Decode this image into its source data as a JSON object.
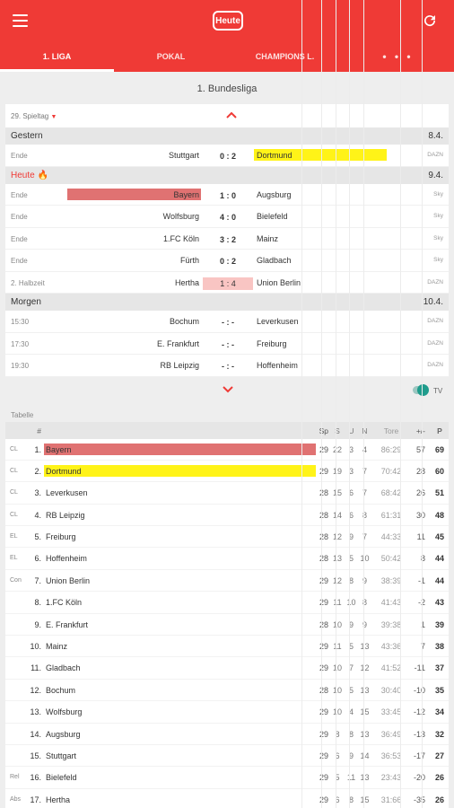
{
  "header": {
    "today_label": "Heute",
    "tabs": [
      "1. LIGA",
      "POKAL",
      "CHAMPIONS L.",
      "• • •"
    ],
    "accent": "#ef3a36"
  },
  "league_title": "1. Bundesliga",
  "matchday": "29. Spieltag",
  "days": [
    {
      "name": "Gestern",
      "date": "8.4.",
      "matches": [
        {
          "status": "Ende",
          "home": "Stuttgart",
          "score": "0 : 2",
          "away": "Dortmund",
          "tv": "DAZN",
          "away_hl": "#fff318"
        }
      ]
    },
    {
      "name": "Heute 🔥",
      "date": "9.4.",
      "today": true,
      "matches": [
        {
          "status": "Ende",
          "home": "Bayern",
          "score": "1 : 0",
          "away": "Augsburg",
          "tv": "Sky",
          "home_hl": "#e07272"
        },
        {
          "status": "Ende",
          "home": "Wolfsburg",
          "score": "4 : 0",
          "away": "Bielefeld",
          "tv": "Sky"
        },
        {
          "status": "Ende",
          "home": "1.FC Köln",
          "score": "3 : 2",
          "away": "Mainz",
          "tv": "Sky"
        },
        {
          "status": "Ende",
          "home": "Fürth",
          "score": "0 : 2",
          "away": "Gladbach",
          "tv": "Sky"
        },
        {
          "status": "2. Halbzeit",
          "home": "Hertha",
          "score": "1 : 4",
          "away": "Union Berlin",
          "tv": "DAZN",
          "live": true
        }
      ]
    },
    {
      "name": "Morgen",
      "date": "10.4.",
      "matches": [
        {
          "status": "15:30",
          "home": "Bochum",
          "score": "- : -",
          "away": "Leverkusen",
          "tv": "DAZN"
        },
        {
          "status": "17:30",
          "home": "E. Frankfurt",
          "score": "- : -",
          "away": "Freiburg",
          "tv": "DAZN"
        },
        {
          "status": "19:30",
          "home": "RB Leipzig",
          "score": "- : -",
          "away": "Hoffenheim",
          "tv": "DAZN"
        }
      ]
    }
  ],
  "tv_toggle_label": "TV",
  "table_label": "Tabelle",
  "table_headers": {
    "pos": "#",
    "sp": "Sp",
    "s": "S",
    "u": "U",
    "n": "N",
    "tore": "Tore",
    "diff": "+/-",
    "p": "P"
  },
  "table": [
    {
      "q": "CL",
      "pos": "1.",
      "team": "Bayern",
      "sp": "29",
      "s": "22",
      "u": "3",
      "n": "4",
      "tore": "86:29",
      "diff": "57",
      "p": "69",
      "hl": "#e07272"
    },
    {
      "q": "CL",
      "pos": "2.",
      "team": "Dortmund",
      "sp": "29",
      "s": "19",
      "u": "3",
      "n": "7",
      "tore": "70:42",
      "diff": "28",
      "p": "60",
      "hl": "#fff318"
    },
    {
      "q": "CL",
      "pos": "3.",
      "team": "Leverkusen",
      "sp": "28",
      "s": "15",
      "u": "6",
      "n": "7",
      "tore": "68:42",
      "diff": "26",
      "p": "51"
    },
    {
      "q": "CL",
      "pos": "4.",
      "team": "RB Leipzig",
      "sp": "28",
      "s": "14",
      "u": "6",
      "n": "8",
      "tore": "61:31",
      "diff": "30",
      "p": "48"
    },
    {
      "q": "EL",
      "pos": "5.",
      "team": "Freiburg",
      "sp": "28",
      "s": "12",
      "u": "9",
      "n": "7",
      "tore": "44:33",
      "diff": "11",
      "p": "45"
    },
    {
      "q": "EL",
      "pos": "6.",
      "team": "Hoffenheim",
      "sp": "28",
      "s": "13",
      "u": "5",
      "n": "10",
      "tore": "50:42",
      "diff": "8",
      "p": "44"
    },
    {
      "q": "Con",
      "pos": "7.",
      "team": "Union Berlin",
      "sp": "29",
      "s": "12",
      "u": "8",
      "n": "9",
      "tore": "38:39",
      "diff": "-1",
      "p": "44"
    },
    {
      "q": "",
      "pos": "8.",
      "team": "1.FC Köln",
      "sp": "29",
      "s": "11",
      "u": "10",
      "n": "8",
      "tore": "41:43",
      "diff": "-2",
      "p": "43"
    },
    {
      "q": "",
      "pos": "9.",
      "team": "E. Frankfurt",
      "sp": "28",
      "s": "10",
      "u": "9",
      "n": "9",
      "tore": "39:38",
      "diff": "1",
      "p": "39"
    },
    {
      "q": "",
      "pos": "10.",
      "team": "Mainz",
      "sp": "29",
      "s": "11",
      "u": "5",
      "n": "13",
      "tore": "43:36",
      "diff": "7",
      "p": "38"
    },
    {
      "q": "",
      "pos": "11.",
      "team": "Gladbach",
      "sp": "29",
      "s": "10",
      "u": "7",
      "n": "12",
      "tore": "41:52",
      "diff": "-11",
      "p": "37"
    },
    {
      "q": "",
      "pos": "12.",
      "team": "Bochum",
      "sp": "28",
      "s": "10",
      "u": "5",
      "n": "13",
      "tore": "30:40",
      "diff": "-10",
      "p": "35"
    },
    {
      "q": "",
      "pos": "13.",
      "team": "Wolfsburg",
      "sp": "29",
      "s": "10",
      "u": "4",
      "n": "15",
      "tore": "33:45",
      "diff": "-12",
      "p": "34"
    },
    {
      "q": "",
      "pos": "14.",
      "team": "Augsburg",
      "sp": "29",
      "s": "8",
      "u": "8",
      "n": "13",
      "tore": "36:49",
      "diff": "-13",
      "p": "32"
    },
    {
      "q": "",
      "pos": "15.",
      "team": "Stuttgart",
      "sp": "29",
      "s": "6",
      "u": "9",
      "n": "14",
      "tore": "36:53",
      "diff": "-17",
      "p": "27"
    },
    {
      "q": "Rel",
      "pos": "16.",
      "team": "Bielefeld",
      "sp": "29",
      "s": "5",
      "u": "11",
      "n": "13",
      "tore": "23:43",
      "diff": "-20",
      "p": "26"
    },
    {
      "q": "Abs",
      "pos": "17.",
      "team": "Hertha",
      "sp": "29",
      "s": "6",
      "u": "8",
      "n": "15",
      "tore": "31:66",
      "diff": "-35",
      "p": "26"
    }
  ]
}
